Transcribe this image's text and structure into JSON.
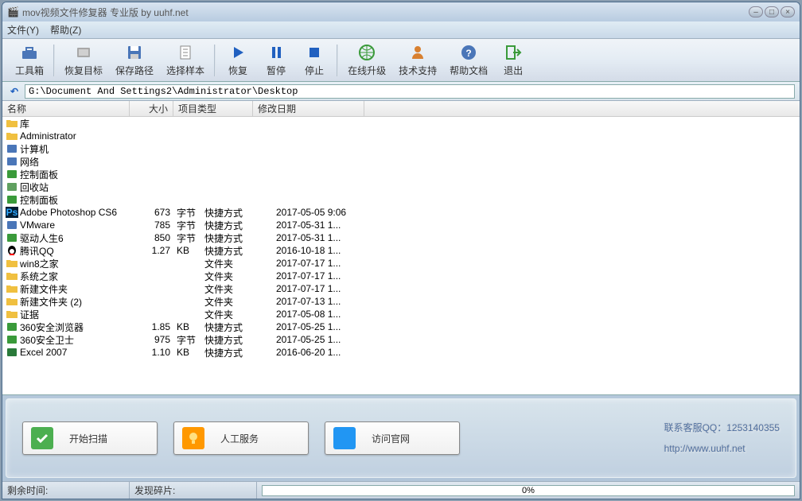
{
  "title": "mov视频文件修复器 专业版 by uuhf.net",
  "menu": {
    "file": "文件(Y)",
    "help": "帮助(Z)"
  },
  "toolbar": {
    "toolbox": "工具箱",
    "target": "恢复目标",
    "savepath": "保存路径",
    "sample": "选择样本",
    "recover": "恢复",
    "pause": "暂停",
    "stop": "停止",
    "upgrade": "在线升级",
    "support": "技术支持",
    "helpdoc": "帮助文档",
    "exit": "退出"
  },
  "path": "G:\\Document And Settings2\\Administrator\\Desktop",
  "columns": {
    "name": "名称",
    "size": "大小",
    "type": "项目类型",
    "date": "修改日期"
  },
  "rows": [
    {
      "icon": "lib",
      "name": "库",
      "size": "",
      "unit": "",
      "type": "",
      "date": ""
    },
    {
      "icon": "folder",
      "name": "Administrator",
      "size": "",
      "unit": "",
      "type": "",
      "date": ""
    },
    {
      "icon": "computer",
      "name": "计算机",
      "size": "",
      "unit": "",
      "type": "",
      "date": ""
    },
    {
      "icon": "network",
      "name": "网络",
      "size": "",
      "unit": "",
      "type": "",
      "date": ""
    },
    {
      "icon": "cpanel",
      "name": "控制面板",
      "size": "",
      "unit": "",
      "type": "",
      "date": ""
    },
    {
      "icon": "recycle",
      "name": "回收站",
      "size": "",
      "unit": "",
      "type": "",
      "date": ""
    },
    {
      "icon": "cpanel",
      "name": "控制面板",
      "size": "",
      "unit": "",
      "type": "",
      "date": ""
    },
    {
      "icon": "ps",
      "name": "Adobe Photoshop CS6",
      "size": "673",
      "unit": "字节",
      "type": "快捷方式",
      "date": "2017-05-05 9:06"
    },
    {
      "icon": "vm",
      "name": "VMware",
      "size": "785",
      "unit": "字节",
      "type": "快捷方式",
      "date": "2017-05-31 1..."
    },
    {
      "icon": "drv",
      "name": "驱动人生6",
      "size": "850",
      "unit": "字节",
      "type": "快捷方式",
      "date": "2017-05-31 1..."
    },
    {
      "icon": "qq",
      "name": "腾讯QQ",
      "size": "1.27",
      "unit": "KB",
      "type": "快捷方式",
      "date": "2016-10-18 1..."
    },
    {
      "icon": "folder",
      "name": "win8之家",
      "size": "",
      "unit": "",
      "type": "文件夹",
      "date": "2017-07-17 1..."
    },
    {
      "icon": "folder",
      "name": "系统之家",
      "size": "",
      "unit": "",
      "type": "文件夹",
      "date": "2017-07-17 1..."
    },
    {
      "icon": "folder",
      "name": "新建文件夹",
      "size": "",
      "unit": "",
      "type": "文件夹",
      "date": "2017-07-17 1..."
    },
    {
      "icon": "folder",
      "name": "新建文件夹 (2)",
      "size": "",
      "unit": "",
      "type": "文件夹",
      "date": "2017-07-13 1..."
    },
    {
      "icon": "folder",
      "name": "证据",
      "size": "",
      "unit": "",
      "type": "文件夹",
      "date": "2017-05-08 1..."
    },
    {
      "icon": "360b",
      "name": "360安全浏览器",
      "size": "1.85",
      "unit": "KB",
      "type": "快捷方式",
      "date": "2017-05-25 1..."
    },
    {
      "icon": "360s",
      "name": "360安全卫士",
      "size": "975",
      "unit": "字节",
      "type": "快捷方式",
      "date": "2017-05-25 1..."
    },
    {
      "icon": "xls",
      "name": "Excel 2007",
      "size": "1.10",
      "unit": "KB",
      "type": "快捷方式",
      "date": "2016-06-20 1..."
    }
  ],
  "buttons": {
    "scan": "开始扫描",
    "manual": "人工服务",
    "website": "访问官网"
  },
  "contact": {
    "qq": "联系客服QQ：1253140355",
    "url": "http://www.uuhf.net"
  },
  "status": {
    "remain": "剩余时间:",
    "fragments": "发现碎片:",
    "percent": "0%"
  }
}
